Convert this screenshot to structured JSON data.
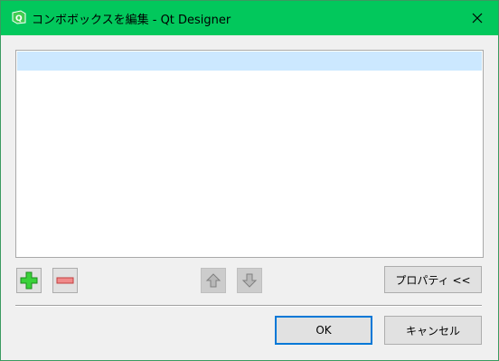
{
  "window": {
    "title": "コンボボックスを編集 - Qt Designer",
    "app_icon": "qt-designer-icon",
    "close_icon": "close-icon",
    "accent_color": "#02c85c"
  },
  "list": {
    "items": [
      ""
    ],
    "selected_index": 0
  },
  "toolbar": {
    "add_icon": "plus-icon",
    "remove_icon": "minus-icon",
    "up_icon": "arrow-up-icon",
    "down_icon": "arrow-down-icon",
    "properties_label": "プロパティ <<"
  },
  "buttons": {
    "ok_label": "OK",
    "cancel_label": "キャンセル"
  }
}
